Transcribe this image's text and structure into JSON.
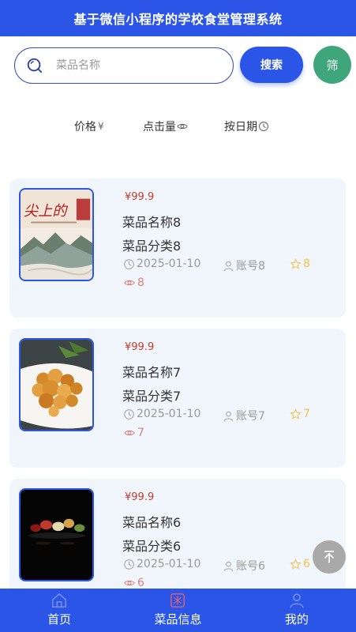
{
  "header": {
    "title": "基于微信小程序的学校食堂管理系统"
  },
  "search": {
    "placeholder": "菜品名称",
    "button_label": "搜索",
    "filter_label": "筛"
  },
  "sort": [
    {
      "label": "价格",
      "symbol": "¥"
    },
    {
      "label": "点击量",
      "symbol": "eye-icon"
    },
    {
      "label": "按日期",
      "symbol": "clock-icon"
    }
  ],
  "items": [
    {
      "price": "¥99.9",
      "name": "菜品名称8",
      "category": "菜品分类8",
      "date": "2025-01-10",
      "account": "账号8",
      "stars": "8",
      "views": "8",
      "image": "landscape-poster"
    },
    {
      "price": "¥99.9",
      "name": "菜品名称7",
      "category": "菜品分类7",
      "date": "2025-01-10",
      "account": "账号7",
      "stars": "7",
      "views": "7",
      "image": "fried-food-plate"
    },
    {
      "price": "¥99.9",
      "name": "菜品名称6",
      "category": "菜品分类6",
      "date": "2025-01-10",
      "account": "账号6",
      "stars": "6",
      "views": "6",
      "image": "dark-food-plate"
    }
  ],
  "tabs": [
    {
      "label": "首页",
      "icon": "home-icon"
    },
    {
      "label": "菜品信息",
      "icon": "dish-icon"
    },
    {
      "label": "我的",
      "icon": "user-icon"
    }
  ],
  "colors": {
    "primary": "#2a55e6",
    "filter": "#3fa57a",
    "price": "#c23b2b",
    "star": "#f0c24b",
    "views": "#d9817a"
  }
}
